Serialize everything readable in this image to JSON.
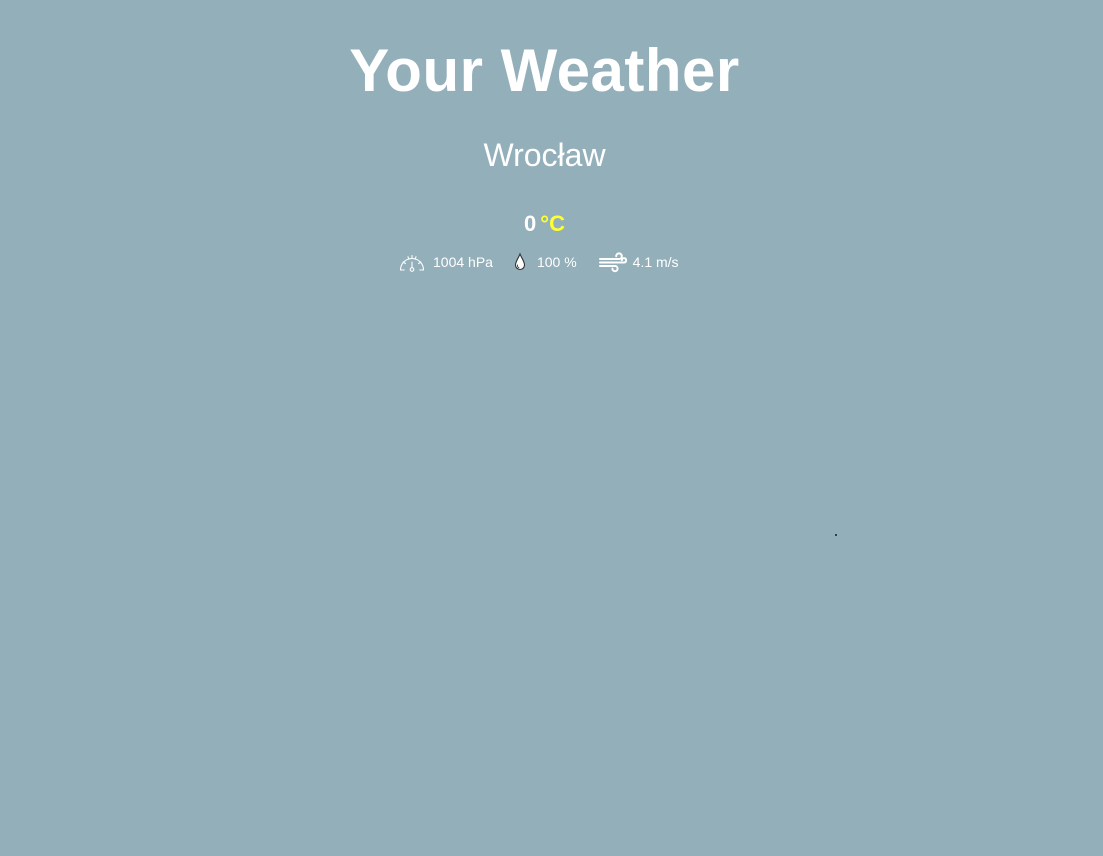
{
  "app": {
    "title": "Your Weather",
    "accent_color": "#ffff33",
    "background_color": "#93afb9"
  },
  "location": {
    "city": "Wrocław"
  },
  "current": {
    "temperature": "0",
    "unit": "°C"
  },
  "stats": {
    "pressure": {
      "icon": "gauge-icon",
      "text": "1004 hPa"
    },
    "humidity": {
      "icon": "water-drop-icon",
      "text": "100 %"
    },
    "wind": {
      "icon": "wind-icon",
      "text": "4.1 m/s"
    }
  }
}
